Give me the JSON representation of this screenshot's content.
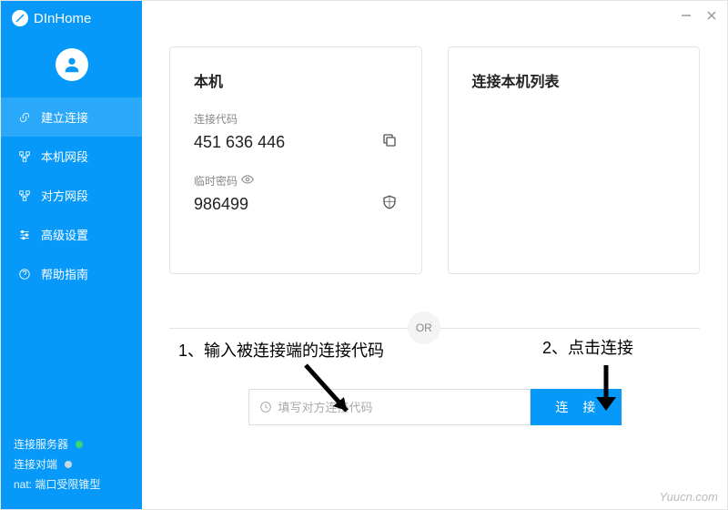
{
  "brand": "DInHome",
  "sidebar": {
    "items": [
      {
        "label": "建立连接"
      },
      {
        "label": "本机网段"
      },
      {
        "label": "对方网段"
      },
      {
        "label": "高级设置"
      },
      {
        "label": "帮助指南"
      }
    ]
  },
  "status": {
    "server": {
      "label": "连接服务器",
      "color": "#3ad66f"
    },
    "peer": {
      "label": "连接对端",
      "color": "#c5d8e6"
    },
    "nat_line": "nat: 端口受限锥型"
  },
  "local_card": {
    "title": "本机",
    "code_label": "连接代码",
    "code_value": "451 636 446",
    "pwd_label": "临时密码",
    "pwd_value": "986499"
  },
  "list_card": {
    "title": "连接本机列表"
  },
  "or_text": "OR",
  "connect": {
    "placeholder": "填写对方连接代码",
    "button": "连 接"
  },
  "annotations": {
    "step1": "1、输入被连接端的连接代码",
    "step2": "2、点击连接"
  },
  "watermark": "Yuucn.com"
}
